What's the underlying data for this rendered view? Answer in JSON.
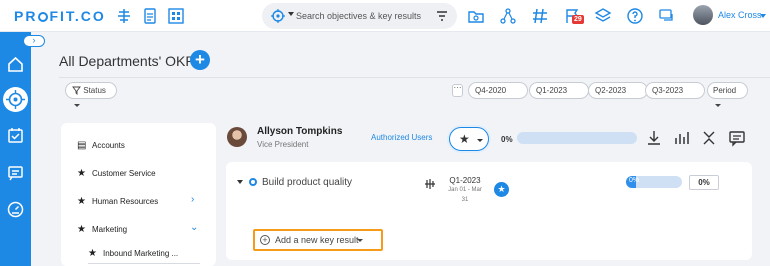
{
  "app": {
    "logo_text_1": "PR",
    "logo_text_2": "FIT.CO"
  },
  "topbar": {
    "search_placeholder": "Search objectives & key results",
    "notification_count": "29",
    "user_name": "Alex Cross"
  },
  "header": {
    "title": "All Departments' OKRs",
    "add_label": "+"
  },
  "filters": {
    "status_label": "Status",
    "more_label": "···",
    "periods": [
      "Q4-2020",
      "Q1-2023",
      "Q2-2023",
      "Q3-2023"
    ],
    "period_select": "Period"
  },
  "departments": [
    {
      "label": "Accounts",
      "icon": "list-icon"
    },
    {
      "label": "Customer Service",
      "icon": "star-icon"
    },
    {
      "label": "Human Resources",
      "icon": "star-icon",
      "chevron": "right"
    },
    {
      "label": "Marketing",
      "icon": "star-icon",
      "chevron": "down"
    },
    {
      "label": "Inbound Marketing ...",
      "icon": "star-icon"
    }
  ],
  "owner": {
    "name": "Allyson Tompkins",
    "role": "Vice President",
    "authorized_users_label": "Authorized Users",
    "progress_label": "0%",
    "progress": 0
  },
  "objective": {
    "title": "Build product quality",
    "period": "Q1-2023",
    "period_dates": "Jan 01 - Mar 31",
    "progress_label": "0%",
    "progress": 0,
    "percent_box": "0%",
    "add_key_result_label": "Add a new key result"
  },
  "colors": {
    "accent": "#1e88e5",
    "highlight": "#f59a1b",
    "badge": "#e53935"
  }
}
